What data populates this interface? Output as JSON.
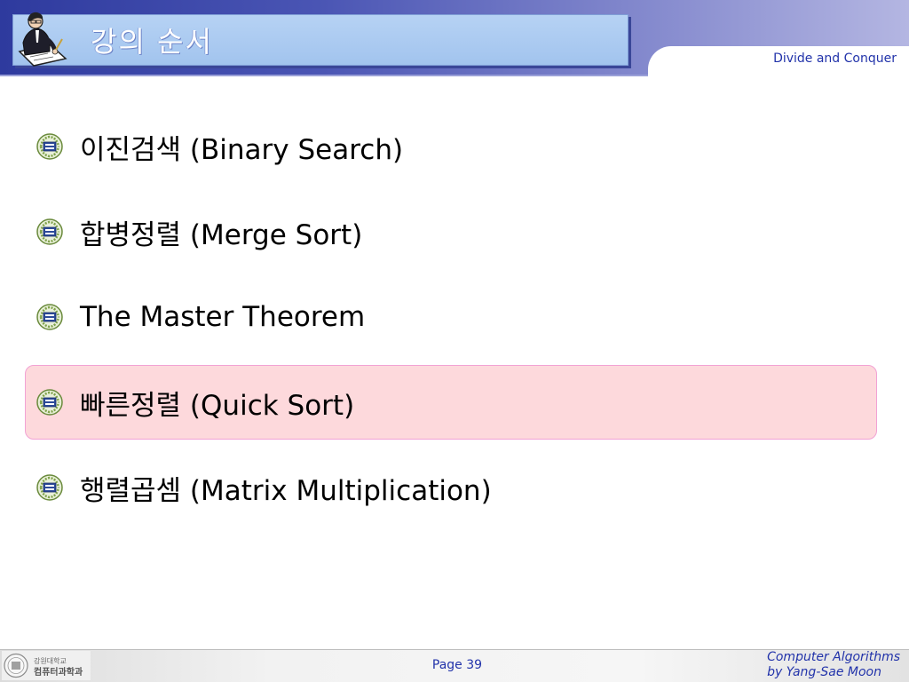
{
  "header": {
    "title": "강의 순서",
    "subtitle": "Divide and Conquer"
  },
  "bullets": [
    {
      "text": "이진검색 (Binary Search)",
      "highlighted": false
    },
    {
      "text": "합병정렬 (Merge Sort)",
      "highlighted": false
    },
    {
      "text": "The Master Theorem",
      "highlighted": false
    },
    {
      "text": "빠른정렬 (Quick Sort)",
      "highlighted": true
    },
    {
      "text": "행렬곱셈 (Matrix Multiplication)",
      "highlighted": false
    }
  ],
  "footer": {
    "logo_line1": "강원대학교",
    "logo_line2": "컴퓨터과학과",
    "page": "Page 39",
    "credit_line1": "Computer Algorithms",
    "credit_line2": "by Yang-Sae Moon"
  },
  "colors": {
    "header_dark": "#2e3a9e",
    "title_box": "#a2c4ee",
    "accent_text": "#2233aa",
    "highlight_fill": "#fdd9dc",
    "highlight_border": "#f2a2d4"
  },
  "icons": {
    "header_logo": "professor-writing-icon",
    "bullet": "university-emblem-icon",
    "footer_logo": "university-seal-icon"
  }
}
